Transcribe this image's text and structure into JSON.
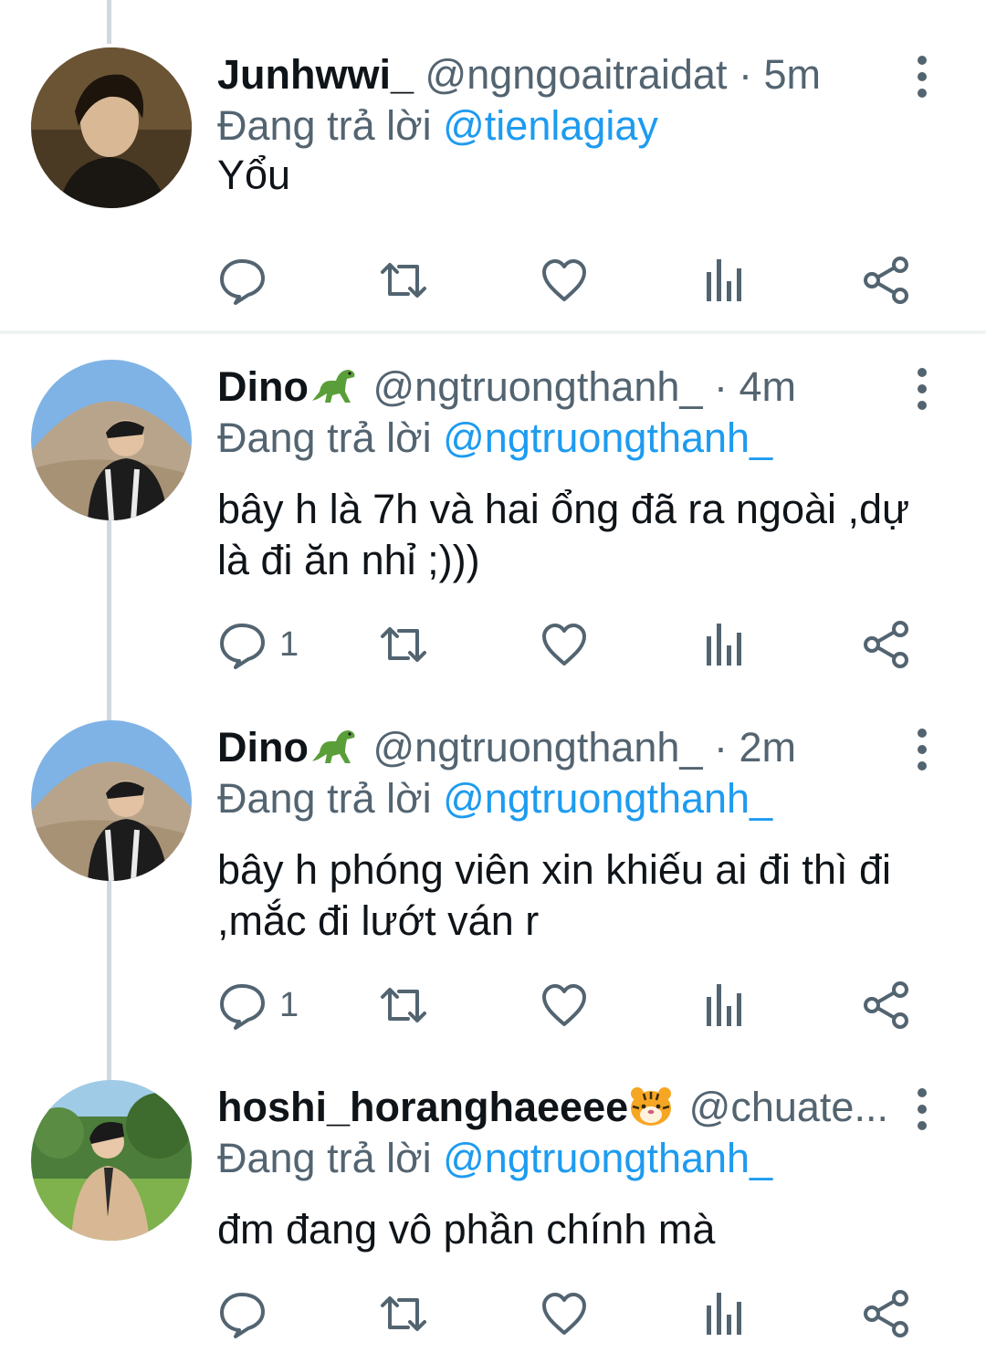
{
  "replying_label": "Đang trả lời",
  "tweets": [
    {
      "name": "Junhwwi_",
      "name_emoji": "",
      "handle": "@ngngoaitraidat",
      "separator": "·",
      "time": "5m",
      "reply_to": "@tienlagiay",
      "text": "Yổu",
      "reply_count": ""
    },
    {
      "name": "Dino",
      "name_emoji": "dinosaur",
      "handle": "@ngtruongthanh_",
      "separator": "·",
      "time": "4m",
      "reply_to": "@ngtruongthanh_",
      "text": "bây h là 7h và hai ổng đã ra ngoài ,dự là đi ăn nhỉ ;)))",
      "reply_count": "1"
    },
    {
      "name": "Dino",
      "name_emoji": "dinosaur",
      "handle": "@ngtruongthanh_",
      "separator": "·",
      "time": "2m",
      "reply_to": "@ngtruongthanh_",
      "text": "bây h phóng viên xin khiếu ai đi thì đi ,mắc đi lướt ván r",
      "reply_count": "1"
    },
    {
      "name": "hoshi_horanghaeeee",
      "name_emoji": "tiger-face",
      "handle": "@chuate...",
      "separator": "",
      "time": "",
      "reply_to": "@ngtruongthanh_",
      "text": "đm đang vô phần chính mà",
      "reply_count": ""
    }
  ],
  "icons": {
    "reply": "reply-icon",
    "retweet": "retweet-icon",
    "like": "heart-icon",
    "analytics": "analytics-icon",
    "share": "share-icon",
    "more": "more-vertical-icon"
  },
  "colors": {
    "text": "#0f1419",
    "secondary": "#536471",
    "mention": "#1d9bf0",
    "thread_line": "#cfd9de"
  }
}
